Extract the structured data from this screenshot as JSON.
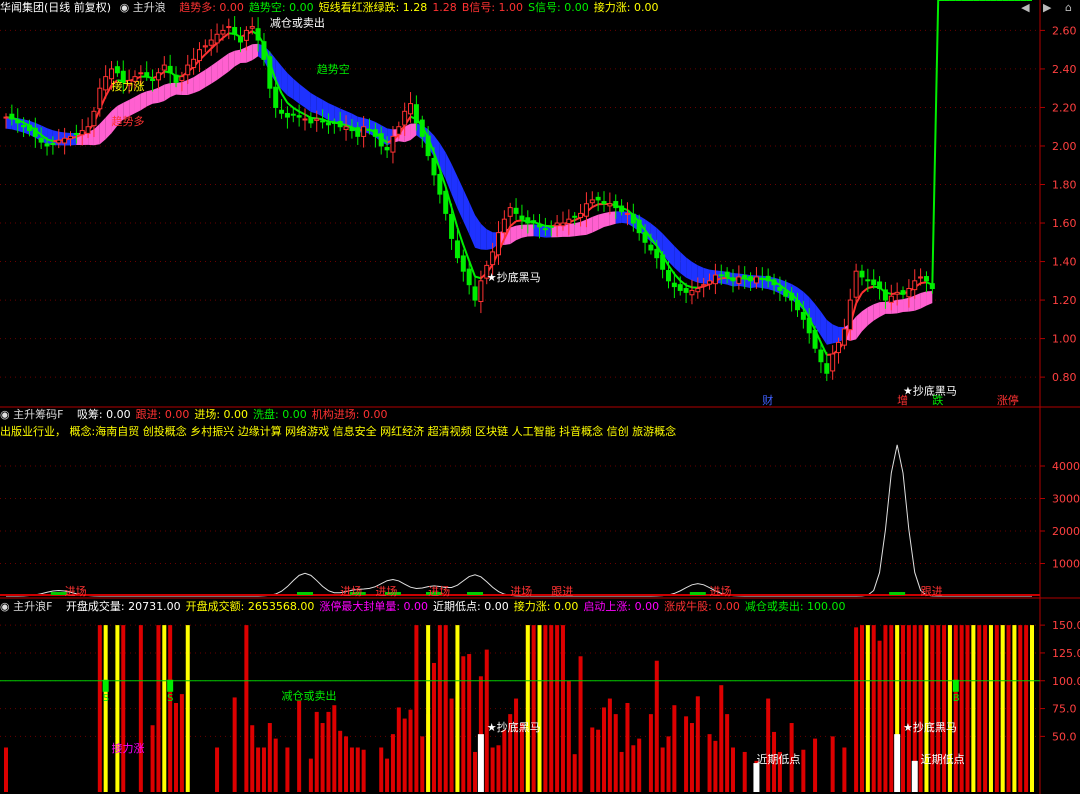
{
  "title": "华闻集团(日线 前复权)",
  "colors": {
    "up": "#ff3232",
    "down": "#00ee00",
    "band_top": "#1e32ff",
    "band_up": "#ff60d0",
    "axis": "#b00000",
    "yellow": "#ffff00",
    "white": "#ffffff",
    "magenta": "#ff00ff",
    "green_line": "#00cc00"
  },
  "window_controls": [
    "◀",
    "▶",
    "⌂"
  ],
  "pane1": {
    "indicator": "主升浪",
    "values": [
      {
        "label": "趋势多: 0.00",
        "color": "#ff3232"
      },
      {
        "label": "趋势空: 0.00",
        "color": "#00ee00"
      },
      {
        "label": "短线看红涨绿跌: 1.28",
        "color": "#ffff00"
      },
      {
        "label": "1.28",
        "color": "#ff3232"
      },
      {
        "label": "B信号: 1.00",
        "color": "#ff3232"
      },
      {
        "label": "S信号: 0.00",
        "color": "#00ee00"
      },
      {
        "label": "接力涨: 0.00",
        "color": "#ffff00"
      }
    ],
    "annotations": [
      {
        "text": "接力涨",
        "color": "#ffff00",
        "x": 18,
        "y": 2.29
      },
      {
        "text": "趋势多",
        "color": "#ff3232",
        "x": 18,
        "y": 2.11
      },
      {
        "text": "趋势空",
        "color": "#00ee00",
        "x": 53,
        "y": 2.38
      },
      {
        "text": "减仓或卖出",
        "color": "#ffffff",
        "x": 45,
        "y": 2.62
      },
      {
        "text": "★抄底黑马",
        "color": "#ffffff",
        "x": 82,
        "y": 1.3
      },
      {
        "text": "★抄底黑马",
        "color": "#ffffff",
        "x": 153,
        "y": 0.71
      }
    ],
    "bottom_tags": [
      {
        "text": "财",
        "color": "#4060ff",
        "x": 129
      },
      {
        "text": "增",
        "color": "#ff3232",
        "x": 152
      },
      {
        "text": "跌",
        "color": "#00ee00",
        "x": 158
      },
      {
        "text": "涨停",
        "color": "#ff3232",
        "x": 169
      }
    ]
  },
  "pane2": {
    "indicator": "主升筹码F",
    "values": [
      {
        "label": "吸筹: 0.00",
        "color": "#ffffff"
      },
      {
        "label": "跟进: 0.00",
        "color": "#ff3232"
      },
      {
        "label": "进场: 0.00",
        "color": "#ffff00"
      },
      {
        "label": "洗盘: 0.00",
        "color": "#00ee00"
      },
      {
        "label": "机构进场: 0.00",
        "color": "#ff3232"
      }
    ],
    "concepts": "出版业行业， 概念:海南自贸 创投概念 乡村振兴 边缘计算 网络游戏 信息安全 网红经济 超清视频 区块链 人工智能 抖音概念 信创 旅游概念",
    "annotations": [
      {
        "text": "进场",
        "color": "#ff3232",
        "x": 10
      },
      {
        "text": "进场",
        "color": "#ff3232",
        "x": 57
      },
      {
        "text": "进场",
        "color": "#ff3232",
        "x": 63
      },
      {
        "text": "进场",
        "color": "#ff3232",
        "x": 72
      },
      {
        "text": "进场",
        "color": "#ff3232",
        "x": 86
      },
      {
        "text": "跟进",
        "color": "#ff3232",
        "x": 93
      },
      {
        "text": "进场",
        "color": "#ff3232",
        "x": 120
      },
      {
        "text": "跟进",
        "color": "#ff3232",
        "x": 156
      }
    ]
  },
  "pane3": {
    "indicator": "主升浪F",
    "values": [
      {
        "label": "开盘成交量: 20731.00",
        "color": "#ffffff"
      },
      {
        "label": "开盘成交额: 2653568.00",
        "color": "#ffff00"
      },
      {
        "label": "涨停最大封单量: 0.00",
        "color": "#ff00ff"
      },
      {
        "label": "近期低点: 0.00",
        "color": "#ffffff"
      },
      {
        "label": "接力涨: 0.00",
        "color": "#ffff00"
      },
      {
        "label": "启动上涨: 0.00",
        "color": "#ff00ff"
      },
      {
        "label": "涨成牛股: 0.00",
        "color": "#ff3232"
      },
      {
        "label": "减仓或卖出: 100.00",
        "color": "#00ee00"
      }
    ],
    "annotations": [
      {
        "text": "接力涨",
        "color": "#ff00ff",
        "x": 18,
        "y": 36
      },
      {
        "text": "减仓或卖出",
        "color": "#00ee00",
        "x": 47,
        "y": 83
      },
      {
        "text": "★抄底黑马",
        "color": "#ffffff",
        "x": 82,
        "y": 55
      },
      {
        "text": "近期低点",
        "color": "#ffffff",
        "x": 128,
        "y": 26
      },
      {
        "text": "★抄底黑马",
        "color": "#ffffff",
        "x": 153,
        "y": 55
      },
      {
        "text": "近期低点",
        "color": "#ffffff",
        "x": 156,
        "y": 26
      }
    ]
  },
  "chart_data": [
    {
      "type": "candlestick",
      "title": "华闻集团(日线 前复权)",
      "ylim": [
        0.65,
        2.68
      ],
      "yticks": [
        "2.60",
        "2.40",
        "2.20",
        "2.00",
        "1.80",
        "1.60",
        "1.40",
        "1.20",
        "1.00",
        "0.80"
      ],
      "close_estimate": [
        2.15,
        2.14,
        2.12,
        2.1,
        2.08,
        2.05,
        2.02,
        2.0,
        2.01,
        2.03,
        2.04,
        2.05,
        2.06,
        2.08,
        2.1,
        2.18,
        2.3,
        2.36,
        2.4,
        2.38,
        2.33,
        2.34,
        2.36,
        2.38,
        2.36,
        2.34,
        2.38,
        2.42,
        2.38,
        2.33,
        2.36,
        2.42,
        2.45,
        2.5,
        2.52,
        2.55,
        2.58,
        2.6,
        2.62,
        2.58,
        2.54,
        2.6,
        2.62,
        2.55,
        2.45,
        2.3,
        2.2,
        2.17,
        2.15,
        2.16,
        2.15,
        2.14,
        2.12,
        2.14,
        2.13,
        2.11,
        2.12,
        2.1,
        2.1,
        2.08,
        2.05,
        2.1,
        2.08,
        2.05,
        2.0,
        1.98,
        2.05,
        2.1,
        2.18,
        2.22,
        2.12,
        2.05,
        1.95,
        1.85,
        1.75,
        1.65,
        1.52,
        1.42,
        1.35,
        1.28,
        1.2,
        1.3,
        1.38,
        1.45,
        1.55,
        1.62,
        1.68,
        1.65,
        1.62,
        1.6,
        1.6,
        1.58,
        1.57,
        1.58,
        1.6,
        1.6,
        1.62,
        1.63,
        1.65,
        1.7,
        1.72,
        1.72,
        1.7,
        1.7,
        1.68,
        1.66,
        1.65,
        1.6,
        1.55,
        1.5,
        1.46,
        1.42,
        1.36,
        1.3,
        1.27,
        1.25,
        1.24,
        1.25,
        1.26,
        1.28,
        1.3,
        1.33,
        1.33,
        1.32,
        1.3,
        1.32,
        1.31,
        1.3,
        1.32,
        1.31,
        1.3,
        1.28,
        1.25,
        1.22,
        1.2,
        1.15,
        1.1,
        1.03,
        0.95,
        0.88,
        0.82,
        0.92,
        0.98,
        1.05,
        1.2,
        1.35,
        1.32,
        1.3,
        1.28,
        1.26,
        1.2,
        1.22,
        1.24,
        1.23,
        1.26,
        1.3,
        1.32,
        1.3,
        1.26
      ]
    },
    {
      "type": "line",
      "title": "主升筹码F",
      "ylim": [
        0,
        4800
      ],
      "yticks": [
        "4000",
        "3000",
        "2000",
        "1000"
      ],
      "peaks": [
        {
          "x": 9,
          "y": 170
        },
        {
          "x": 51,
          "y": 700
        },
        {
          "x": 60,
          "y": 190
        },
        {
          "x": 66,
          "y": 500
        },
        {
          "x": 73,
          "y": 300
        },
        {
          "x": 80,
          "y": 650
        },
        {
          "x": 118,
          "y": 380
        },
        {
          "x": 152,
          "y": 4650
        }
      ]
    },
    {
      "type": "bar",
      "title": "主升浪F",
      "ylim": [
        0,
        160
      ],
      "yticks": [
        "150.0",
        "125.0",
        "100.0",
        "75.0",
        "50.0"
      ],
      "reference_line": 100,
      "red_bars": [
        {
          "x": 0,
          "v": 40
        },
        {
          "x": 16,
          "v": 150
        },
        {
          "x": 20,
          "v": 150
        },
        {
          "x": 23,
          "v": 150
        },
        {
          "x": 25,
          "v": 60
        },
        {
          "x": 26,
          "v": 150
        },
        {
          "x": 28,
          "v": 150
        },
        {
          "x": 29,
          "v": 80
        },
        {
          "x": 30,
          "v": 88
        },
        {
          "x": 36,
          "v": 40
        },
        {
          "x": 39,
          "v": 85
        },
        {
          "x": 41,
          "v": 150
        },
        {
          "x": 42,
          "v": 60
        },
        {
          "x": 43,
          "v": 40
        },
        {
          "x": 44,
          "v": 40
        },
        {
          "x": 45,
          "v": 62
        },
        {
          "x": 46,
          "v": 48
        },
        {
          "x": 48,
          "v": 40
        },
        {
          "x": 50,
          "v": 82
        },
        {
          "x": 52,
          "v": 30
        },
        {
          "x": 53,
          "v": 72
        },
        {
          "x": 54,
          "v": 62
        },
        {
          "x": 55,
          "v": 72
        },
        {
          "x": 56,
          "v": 78
        },
        {
          "x": 57,
          "v": 55
        },
        {
          "x": 58,
          "v": 50
        },
        {
          "x": 59,
          "v": 40
        },
        {
          "x": 60,
          "v": 40
        },
        {
          "x": 61,
          "v": 38
        },
        {
          "x": 64,
          "v": 40
        },
        {
          "x": 65,
          "v": 30
        },
        {
          "x": 66,
          "v": 52
        },
        {
          "x": 67,
          "v": 76
        },
        {
          "x": 68,
          "v": 66
        },
        {
          "x": 69,
          "v": 74
        },
        {
          "x": 70,
          "v": 150
        },
        {
          "x": 71,
          "v": 50
        },
        {
          "x": 72,
          "v": 70
        },
        {
          "x": 73,
          "v": 116
        },
        {
          "x": 74,
          "v": 150
        },
        {
          "x": 75,
          "v": 150
        },
        {
          "x": 76,
          "v": 84
        },
        {
          "x": 77,
          "v": 86
        },
        {
          "x": 78,
          "v": 122
        },
        {
          "x": 79,
          "v": 124
        },
        {
          "x": 80,
          "v": 36
        },
        {
          "x": 81,
          "v": 104
        },
        {
          "x": 82,
          "v": 128
        },
        {
          "x": 83,
          "v": 40
        },
        {
          "x": 84,
          "v": 42
        },
        {
          "x": 85,
          "v": 56
        },
        {
          "x": 86,
          "v": 70
        },
        {
          "x": 87,
          "v": 84
        },
        {
          "x": 88,
          "v": 62
        },
        {
          "x": 89,
          "v": 150
        },
        {
          "x": 90,
          "v": 150
        },
        {
          "x": 91,
          "v": 36
        },
        {
          "x": 92,
          "v": 150
        },
        {
          "x": 93,
          "v": 150
        },
        {
          "x": 94,
          "v": 150
        },
        {
          "x": 95,
          "v": 150
        },
        {
          "x": 96,
          "v": 100
        },
        {
          "x": 97,
          "v": 34
        },
        {
          "x": 98,
          "v": 122
        },
        {
          "x": 100,
          "v": 58
        },
        {
          "x": 101,
          "v": 56
        },
        {
          "x": 102,
          "v": 76
        },
        {
          "x": 103,
          "v": 84
        },
        {
          "x": 104,
          "v": 70
        },
        {
          "x": 105,
          "v": 36
        },
        {
          "x": 106,
          "v": 80
        },
        {
          "x": 107,
          "v": 42
        },
        {
          "x": 108,
          "v": 48
        },
        {
          "x": 110,
          "v": 70
        },
        {
          "x": 111,
          "v": 118
        },
        {
          "x": 112,
          "v": 40
        },
        {
          "x": 113,
          "v": 50
        },
        {
          "x": 114,
          "v": 78
        },
        {
          "x": 116,
          "v": 68
        },
        {
          "x": 117,
          "v": 62
        },
        {
          "x": 118,
          "v": 86
        },
        {
          "x": 120,
          "v": 52
        },
        {
          "x": 121,
          "v": 46
        },
        {
          "x": 122,
          "v": 96
        },
        {
          "x": 123,
          "v": 70
        },
        {
          "x": 124,
          "v": 40
        },
        {
          "x": 126,
          "v": 36
        },
        {
          "x": 128,
          "v": 28
        },
        {
          "x": 130,
          "v": 84
        },
        {
          "x": 131,
          "v": 54
        },
        {
          "x": 132,
          "v": 36
        },
        {
          "x": 134,
          "v": 62
        },
        {
          "x": 136,
          "v": 38
        },
        {
          "x": 138,
          "v": 48
        },
        {
          "x": 141,
          "v": 50
        },
        {
          "x": 143,
          "v": 40
        },
        {
          "x": 145,
          "v": 148
        },
        {
          "x": 146,
          "v": 150
        },
        {
          "x": 148,
          "v": 150
        },
        {
          "x": 149,
          "v": 136
        },
        {
          "x": 150,
          "v": 150
        },
        {
          "x": 151,
          "v": 150
        },
        {
          "x": 152,
          "v": 150
        },
        {
          "x": 153,
          "v": 150
        },
        {
          "x": 154,
          "v": 150
        },
        {
          "x": 155,
          "v": 150
        },
        {
          "x": 156,
          "v": 150
        },
        {
          "x": 157,
          "v": 150
        },
        {
          "x": 158,
          "v": 150
        },
        {
          "x": 159,
          "v": 150
        },
        {
          "x": 160,
          "v": 150
        },
        {
          "x": 161,
          "v": 150
        },
        {
          "x": 162,
          "v": 150
        },
        {
          "x": 163,
          "v": 150
        },
        {
          "x": 164,
          "v": 150
        },
        {
          "x": 165,
          "v": 150
        },
        {
          "x": 166,
          "v": 150
        },
        {
          "x": 167,
          "v": 150
        },
        {
          "x": 168,
          "v": 150
        },
        {
          "x": 169,
          "v": 150
        },
        {
          "x": 170,
          "v": 150
        },
        {
          "x": 171,
          "v": 150
        },
        {
          "x": 172,
          "v": 150
        },
        {
          "x": 173,
          "v": 150
        },
        {
          "x": 174,
          "v": 150
        },
        {
          "x": 175,
          "v": 150
        }
      ],
      "yellow_bars": [
        17,
        19,
        27,
        31,
        72,
        77,
        89,
        91,
        147,
        152,
        157,
        161,
        165,
        168,
        170,
        172,
        175
      ],
      "white_bars": [
        {
          "x": 81,
          "v": 52
        },
        {
          "x": 128,
          "v": 26
        },
        {
          "x": 152,
          "v": 52
        },
        {
          "x": 155,
          "v": 28
        }
      ],
      "green_markers": [
        {
          "x": 17,
          "label": "S"
        },
        {
          "x": 28,
          "label": "S"
        },
        {
          "x": 162,
          "label": "B"
        }
      ]
    }
  ]
}
